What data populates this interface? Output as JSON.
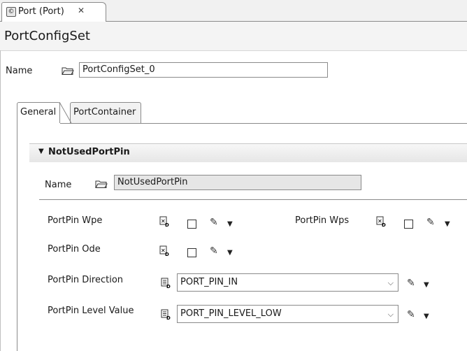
{
  "editor_tab": {
    "title": "Port (Port)",
    "icon": "module-config-icon",
    "close_glyph": "✕"
  },
  "header": {
    "title": "PortConfigSet"
  },
  "top_name": {
    "label": "Name",
    "value": "PortConfigSet_0"
  },
  "tabs": [
    {
      "label": "General",
      "active": true
    },
    {
      "label": "PortContainer",
      "active": false
    }
  ],
  "section": {
    "title": "NotUsedPortPin",
    "expanded": true,
    "name_label": "Name",
    "name_value": "NotUsedPortPin"
  },
  "params": {
    "wpe": {
      "label": "PortPin Wpe",
      "checked": false
    },
    "wps": {
      "label": "PortPin Wps",
      "checked": false
    },
    "ode": {
      "label": "PortPin Ode",
      "checked": false
    },
    "direction": {
      "label": "PortPin Direction",
      "value": "PORT_PIN_IN"
    },
    "level": {
      "label": "PortPin Level Value",
      "value": "PORT_PIN_LEVEL_LOW"
    }
  },
  "colors": {
    "border": "#8a8a8a",
    "readonly_bg": "#e6e6e6",
    "section_bg": "#e6e6e6"
  }
}
